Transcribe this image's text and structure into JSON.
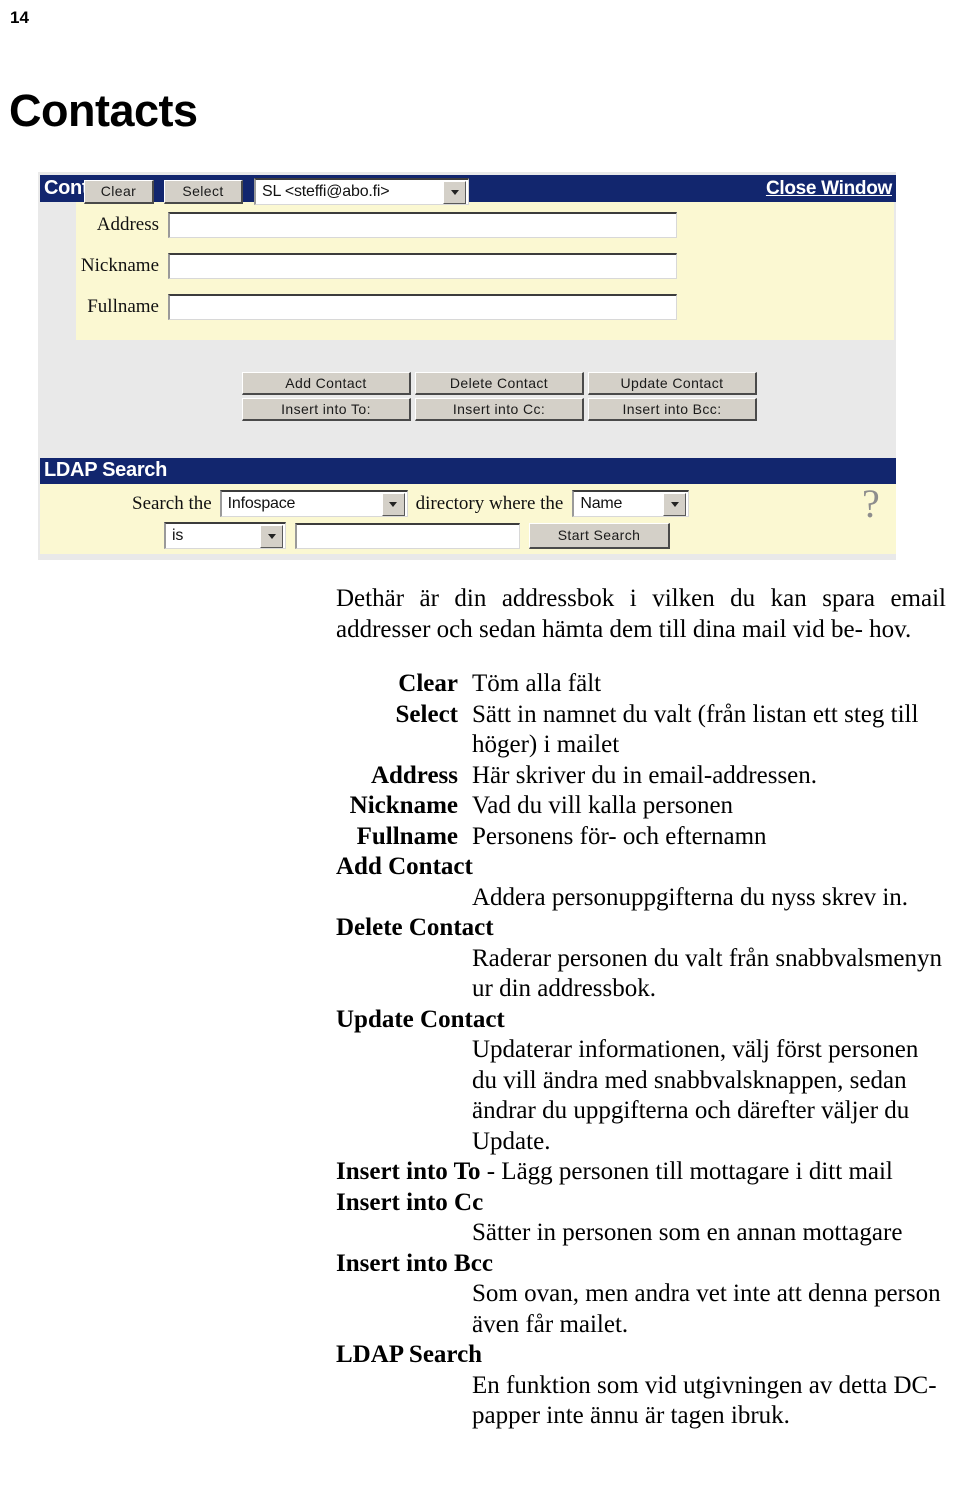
{
  "page": {
    "number": "14",
    "title": "Contacts"
  },
  "screenshot": {
    "contacts_panel": {
      "bar_title": "Contacts",
      "close_link": "Close Window",
      "buttons": {
        "clear": "Clear",
        "select": "Select"
      },
      "contact_select": {
        "value": "SL <steffi@abo.fi>",
        "arrow_icon": "chevron-down-icon"
      },
      "fields": [
        {
          "label": "Address",
          "value": ""
        },
        {
          "label": "Nickname",
          "value": ""
        },
        {
          "label": "Fullname",
          "value": ""
        }
      ],
      "actions_row1": [
        "Add Contact",
        "Delete Contact",
        "Update Contact"
      ],
      "actions_row2": [
        "Insert into To:",
        "Insert into Cc:",
        "Insert into Bcc:"
      ]
    },
    "ldap_panel": {
      "bar_title": "LDAP Search",
      "label_search_the": "Search the",
      "directory_select": {
        "value": "Infospace",
        "arrow_icon": "chevron-down-icon"
      },
      "label_directory_where": "directory where the",
      "attribute_select": {
        "value": "Name",
        "arrow_icon": "chevron-down-icon"
      },
      "operator_select": {
        "value": "is",
        "arrow_icon": "chevron-down-icon"
      },
      "query_input": {
        "value": ""
      },
      "start_search_button": "Start Search",
      "help_icon_glyph": "?"
    },
    "colors": {
      "title_bar": "#12266e",
      "panel_background": "#fbf8d2",
      "window_background": "#e9e9e9",
      "button_face": "#d4d0c8"
    }
  },
  "body": {
    "intro_line1": "Dethär är din addressbok i vilken du kan spara email",
    "intro_line2": "addresser och sedan hämta dem till dina mail vid be-",
    "intro_line3": "hov.",
    "definitions": [
      {
        "style": "inline",
        "term": "Clear",
        "desc": "Töm alla fält"
      },
      {
        "style": "inline",
        "term": "Select",
        "desc": "Sätt in namnet du valt (från listan ett steg till höger) i mailet"
      },
      {
        "style": "inline",
        "term": "Address",
        "desc": "Här skriver du in email-addressen."
      },
      {
        "style": "inline",
        "term": "Nickname",
        "desc": "Vad du vill kalla personen"
      },
      {
        "style": "inline",
        "term": "Fullname",
        "desc": "Personens för- och efternamn"
      },
      {
        "style": "stacked",
        "term": "Add Contact",
        "desc": "Addera personuppgifterna du nyss skrev in."
      },
      {
        "style": "stacked",
        "term": "Delete Contact",
        "desc": "Raderar personen du valt från snabbvalsmenyn ur din addressbok."
      },
      {
        "style": "stacked",
        "term": "Update Contact",
        "desc": "Updaterar informationen, välj först personen du vill ändra med snabbvalsknappen, sedan ändrar du uppgifterna och därefter väljer du Update."
      },
      {
        "style": "runon",
        "term": "Insert into To",
        "desc": " - Lägg personen till mottagare i ditt mail"
      },
      {
        "style": "stacked",
        "term": "Insert into Cc",
        "desc": "Sätter in personen som en annan mottagare"
      },
      {
        "style": "stacked",
        "term": "Insert into Bcc",
        "desc": "Som ovan, men andra vet inte att denna person även får mailet."
      },
      {
        "style": "stacked",
        "term": "LDAP Search",
        "desc": "En funktion som vid utgivningen av detta DC-papper inte ännu är tagen ibruk."
      }
    ]
  }
}
